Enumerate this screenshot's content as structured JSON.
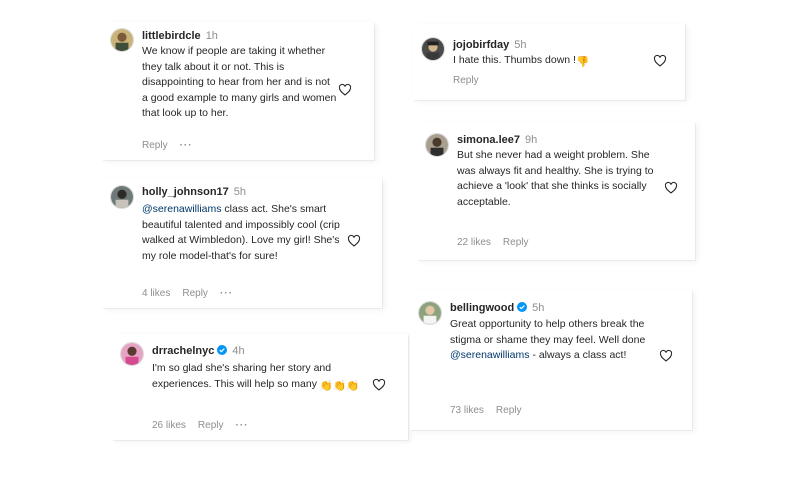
{
  "comments": [
    {
      "username": "littlebirdcle",
      "time": "1h",
      "text": "We know if people are taking it whether they talk about it or not. This is disappointing to hear from her and is not a good example to many girls and women that look up to her.",
      "reply_label": "Reply",
      "more_label": "···"
    },
    {
      "username": "holly_johnson17",
      "time": "5h",
      "mention": "@serenawilliams",
      "text": " class act. She's smart beautiful talented and impossibly cool (crip walked at Wimbledon). Love my girl! She's my role model-that's for sure!",
      "likes": "4 likes",
      "reply_label": "Reply",
      "more_label": "···"
    },
    {
      "username": "drrachelnyc",
      "time": "4h",
      "verified": true,
      "text": "I'm so glad she's sharing her story and experiences. This will help so many",
      "emoji": "👏👏👏",
      "likes": "26 likes",
      "reply_label": "Reply",
      "more_label": "···"
    },
    {
      "username": "jojobirfday",
      "time": "5h",
      "text": "I hate this. Thumbs down !",
      "emoji": "👎",
      "reply_label": "Reply"
    },
    {
      "username": "simona.lee7",
      "time": "9h",
      "text": "But she never had a weight problem. She was always fit and healthy. She is trying to achieve a 'look' that she thinks is socially acceptable.",
      "likes": "22 likes",
      "reply_label": "Reply"
    },
    {
      "username": "bellingwood",
      "time": "5h",
      "verified": true,
      "text_before": "Great opportunity to help others break the stigma or shame they may feel. Well done ",
      "mention": "@serenawilliams",
      "text_after": " - always a class act!",
      "likes": "73 likes",
      "reply_label": "Reply"
    }
  ],
  "colors": {
    "text": "#262626",
    "muted": "#8e8e8e",
    "mention": "#00376b",
    "verified": "#0095f6"
  },
  "icons": [
    "heart-outline-icon",
    "verified-badge-icon",
    "more-icon"
  ]
}
